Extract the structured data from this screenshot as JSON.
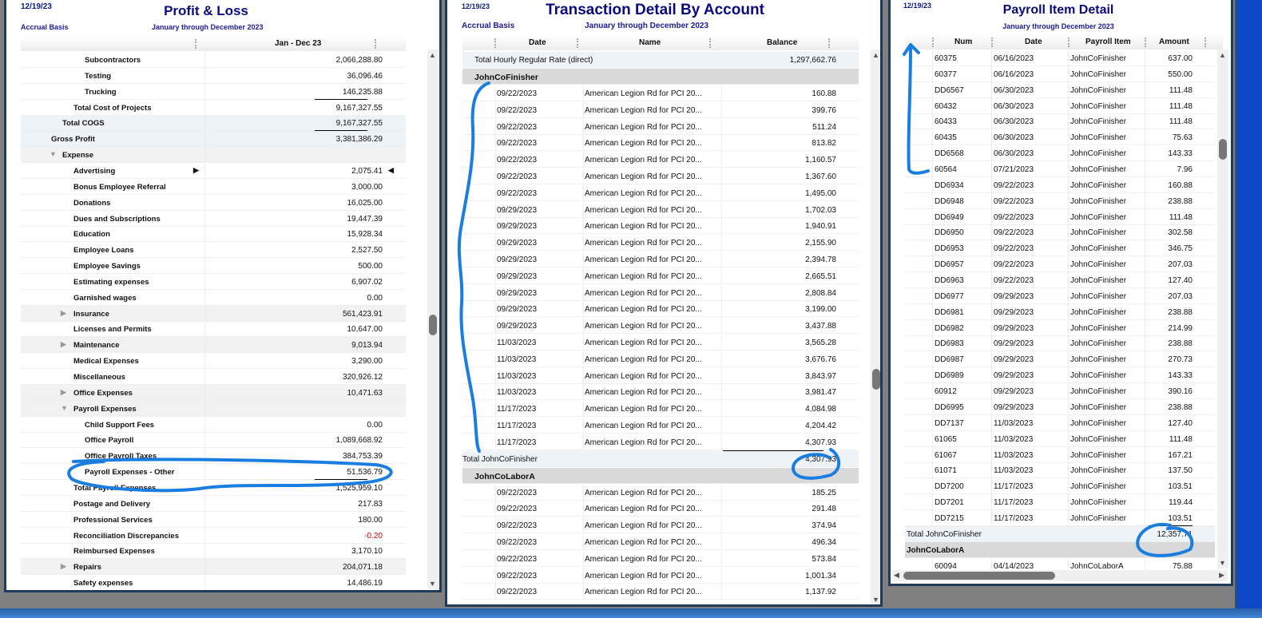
{
  "pnl": {
    "date": "12/19/23",
    "title": "Profit & Loss",
    "basis": "Accrual Basis",
    "period": "January through December 2023",
    "col": "Jan - Dec 23",
    "rows": [
      {
        "l": "Subcontractors",
        "i": 3,
        "v": "2,066,288.80"
      },
      {
        "l": "Testing",
        "i": 3,
        "v": "36,096.46"
      },
      {
        "l": "Trucking",
        "i": 3,
        "v": "146,235.88",
        "u": 1
      },
      {
        "l": "Total Cost of Projects",
        "i": 2,
        "v": "9,167,327.55",
        "u": 1
      },
      {
        "l": "Total COGS",
        "i": 1,
        "v": "9,167,327.55",
        "s": "b",
        "u": 1
      },
      {
        "l": "Gross Profit",
        "i": 0,
        "v": "3,381,386.29",
        "s": "b"
      },
      {
        "l": "Expense",
        "i": 1,
        "v": "",
        "s": "g",
        "t": "open"
      },
      {
        "l": "Advertising",
        "i": 2,
        "v": "2,075.41",
        "m": 1
      },
      {
        "l": "Bonus Employee Referral",
        "i": 2,
        "v": "3,000.00"
      },
      {
        "l": "Donations",
        "i": 2,
        "v": "16,025.00"
      },
      {
        "l": "Dues and Subscriptions",
        "i": 2,
        "v": "19,447.39"
      },
      {
        "l": "Education",
        "i": 2,
        "v": "15,928.34"
      },
      {
        "l": "Employee Loans",
        "i": 2,
        "v": "2,527.50"
      },
      {
        "l": "Employee Savings",
        "i": 2,
        "v": "500.00"
      },
      {
        "l": "Estimating expenses",
        "i": 2,
        "v": "6,907.02"
      },
      {
        "l": "Garnished wages",
        "i": 2,
        "v": "0.00"
      },
      {
        "l": "Insurance",
        "i": 2,
        "v": "561,423.91",
        "s": "g",
        "t": "closed"
      },
      {
        "l": "Licenses and Permits",
        "i": 2,
        "v": "10,647.00"
      },
      {
        "l": "Maintenance",
        "i": 2,
        "v": "9,013.94",
        "s": "g",
        "t": "closed"
      },
      {
        "l": "Medical Expenses",
        "i": 2,
        "v": "3,290.00"
      },
      {
        "l": "Miscellaneous",
        "i": 2,
        "v": "320,926.12"
      },
      {
        "l": "Office Expenses",
        "i": 2,
        "v": "10,471.63",
        "s": "g",
        "t": "closed"
      },
      {
        "l": "Payroll Expenses",
        "i": 2,
        "v": "",
        "s": "g",
        "t": "open"
      },
      {
        "l": "Child Support Fees",
        "i": 3,
        "v": "0.00"
      },
      {
        "l": "Office Payroll",
        "i": 3,
        "v": "1,089,668.92"
      },
      {
        "l": "Office Payroll Taxes",
        "i": 3,
        "v": "384,753.39"
      },
      {
        "l": "Payroll Expenses - Other",
        "i": 3,
        "v": "51,536.79",
        "u": 1
      },
      {
        "l": "Total Payroll Expenses",
        "i": 2,
        "v": "1,525,959.10"
      },
      {
        "l": "Postage and Delivery",
        "i": 2,
        "v": "217.83"
      },
      {
        "l": "Professional Services",
        "i": 2,
        "v": "180.00"
      },
      {
        "l": "Reconciliation Discrepancies",
        "i": 2,
        "v": "-0.20",
        "neg": 1
      },
      {
        "l": "Reimbursed Expenses",
        "i": 2,
        "v": "3,170.10"
      },
      {
        "l": "Repairs",
        "i": 2,
        "v": "204,071.18",
        "s": "g",
        "t": "closed"
      },
      {
        "l": "Safety expenses",
        "i": 2,
        "v": "14,486.19"
      }
    ]
  },
  "tda": {
    "date": "12/19/23",
    "title": "Transaction Detail By Account",
    "basis": "Accrual Basis",
    "period": "January through December 2023",
    "cols": [
      "Date",
      "Name",
      "Balance"
    ],
    "top_total": {
      "l": "Total Hourly Regular Rate (direct)",
      "v": "1,297,662.76"
    },
    "groups": [
      {
        "name": "JohnCoFinisher",
        "desc": "American Legion Rd for PCI 20...",
        "rows": [
          [
            "09/22/2023",
            "160.88"
          ],
          [
            "09/22/2023",
            "399.76"
          ],
          [
            "09/22/2023",
            "511.24"
          ],
          [
            "09/22/2023",
            "813.82"
          ],
          [
            "09/22/2023",
            "1,160.57"
          ],
          [
            "09/22/2023",
            "1,367.60"
          ],
          [
            "09/22/2023",
            "1,495.00"
          ],
          [
            "09/29/2023",
            "1,702.03"
          ],
          [
            "09/29/2023",
            "1,940.91"
          ],
          [
            "09/29/2023",
            "2,155.90"
          ],
          [
            "09/29/2023",
            "2,394.78"
          ],
          [
            "09/29/2023",
            "2,665.51"
          ],
          [
            "09/29/2023",
            "2,808.84"
          ],
          [
            "09/29/2023",
            "3,199.00"
          ],
          [
            "09/29/2023",
            "3,437.88"
          ],
          [
            "11/03/2023",
            "3,565.28"
          ],
          [
            "11/03/2023",
            "3,676.76"
          ],
          [
            "11/03/2023",
            "3,843.97"
          ],
          [
            "11/03/2023",
            "3,981.47"
          ],
          [
            "11/17/2023",
            "4,084.98"
          ],
          [
            "11/17/2023",
            "4,204.42"
          ],
          [
            "11/17/2023",
            "4,307.93"
          ]
        ],
        "total": {
          "l": "Total JohnCoFinisher",
          "v": "4,307.93"
        }
      },
      {
        "name": "JohnCoLaborA",
        "desc": "American Legion Rd for PCI 20...",
        "rows": [
          [
            "09/22/2023",
            "185.25"
          ],
          [
            "09/22/2023",
            "291.48"
          ],
          [
            "09/22/2023",
            "374.94"
          ],
          [
            "09/22/2023",
            "496.34"
          ],
          [
            "09/22/2023",
            "573.84"
          ],
          [
            "09/22/2023",
            "1,001.34"
          ],
          [
            "09/22/2023",
            "1,137.92"
          ]
        ]
      }
    ]
  },
  "pid": {
    "date": "12/19/23",
    "title": "Payroll Item Detail",
    "period": "January through December 2023",
    "cols": [
      "Num",
      "Date",
      "Payroll Item",
      "Amount"
    ],
    "item": "JohnCoFinisher",
    "rows": [
      [
        "60375",
        "06/16/2023",
        "637.00"
      ],
      [
        "60377",
        "06/16/2023",
        "550.00"
      ],
      [
        "DD6567",
        "06/30/2023",
        "111.48"
      ],
      [
        "60432",
        "06/30/2023",
        "111.48"
      ],
      [
        "60433",
        "06/30/2023",
        "111.48"
      ],
      [
        "60435",
        "06/30/2023",
        "75.63"
      ],
      [
        "DD6568",
        "06/30/2023",
        "143.33"
      ],
      [
        "60564",
        "07/21/2023",
        "7.96"
      ],
      [
        "DD6934",
        "09/22/2023",
        "160.88"
      ],
      [
        "DD6948",
        "09/22/2023",
        "238.88"
      ],
      [
        "DD6949",
        "09/22/2023",
        "111.48"
      ],
      [
        "DD6950",
        "09/22/2023",
        "302.58"
      ],
      [
        "DD6953",
        "09/22/2023",
        "346.75"
      ],
      [
        "DD6957",
        "09/22/2023",
        "207.03"
      ],
      [
        "DD6963",
        "09/22/2023",
        "127.40"
      ],
      [
        "DD6977",
        "09/29/2023",
        "207.03"
      ],
      [
        "DD6981",
        "09/29/2023",
        "238.88"
      ],
      [
        "DD6982",
        "09/29/2023",
        "214.99"
      ],
      [
        "DD6983",
        "09/29/2023",
        "238.88"
      ],
      [
        "DD6987",
        "09/29/2023",
        "270.73"
      ],
      [
        "DD6989",
        "09/29/2023",
        "143.33"
      ],
      [
        "60912",
        "09/29/2023",
        "390.16"
      ],
      [
        "DD6995",
        "09/29/2023",
        "238.88"
      ],
      [
        "DD7137",
        "11/03/2023",
        "127.40"
      ],
      [
        "61065",
        "11/03/2023",
        "111.48"
      ],
      [
        "61067",
        "11/03/2023",
        "167.21"
      ],
      [
        "61071",
        "11/03/2023",
        "137.50"
      ],
      [
        "DD7200",
        "11/17/2023",
        "103.51"
      ],
      [
        "DD7201",
        "11/17/2023",
        "119.44"
      ],
      [
        "DD7215",
        "11/17/2023",
        "103.51"
      ]
    ],
    "total": {
      "l": "Total JohnCoFinisher",
      "v": "12,357.71"
    },
    "group2": "JohnCoLaborA",
    "rows2": [
      [
        "60094",
        "04/14/2023",
        "JohnCoLaborA",
        "75.88"
      ]
    ]
  },
  "colors": {
    "title": "#0a0a80",
    "annotation": "#1a7de0",
    "negative": "#e00000"
  }
}
